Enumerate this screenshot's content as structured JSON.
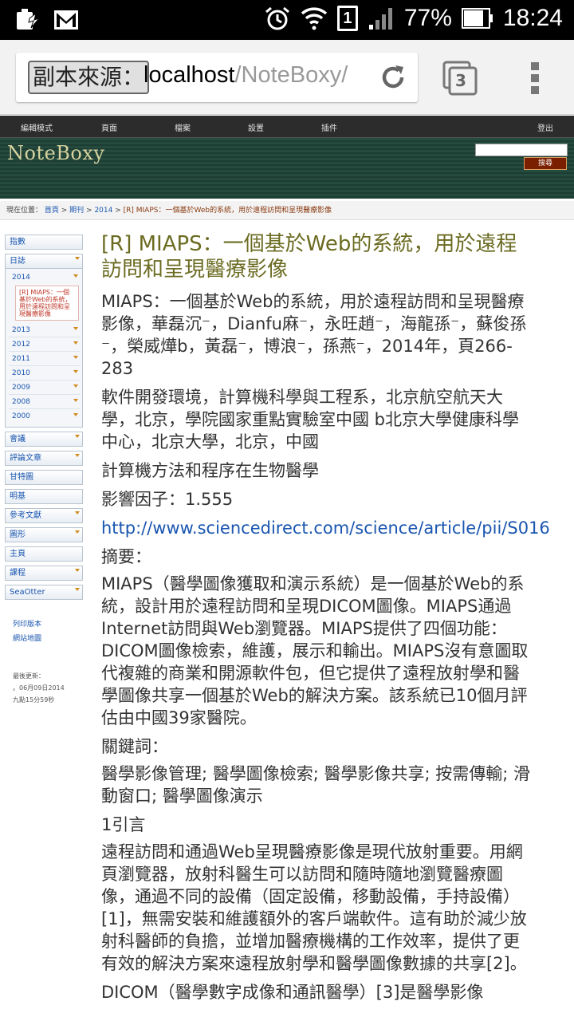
{
  "status_bar": {
    "battery_pct": "77%",
    "time": "18:24",
    "sim_slot": "1"
  },
  "browser": {
    "chip_label": "副本來源：",
    "url_host": "localhost",
    "url_path": "/NoteBoxy/",
    "tab_count": "3"
  },
  "site_nav": {
    "items": [
      "編輯模式",
      "頁面",
      "檔案",
      "設置",
      "插件"
    ],
    "logout": "登出"
  },
  "header": {
    "logo": "NoteBoxy",
    "search_btn": "搜尋"
  },
  "breadcrumb": {
    "prefix": "現在位置：",
    "home": "首頁",
    "journal": "期刊",
    "year": "2014",
    "current": "[R] MIAPS：一個基於Web的系統，用於遠程訪問和呈現醫療影像",
    "sep": " > "
  },
  "sidebar": {
    "index": "指數",
    "log": "日誌",
    "year_open": "2014",
    "current_entry": "[R] MIAPS：一個基於Web的系統，用於遠程訪問和呈現醫療影像",
    "years": [
      "2013",
      "2012",
      "2011",
      "2010",
      "2009",
      "2008",
      "2000"
    ],
    "items": [
      "會議",
      "評論文章",
      "甘特圖",
      "明基",
      "參考文獻",
      "圖形",
      "主頁",
      "課程",
      "SeaOtter"
    ],
    "print": "列印版本",
    "sitemap": "網站地圖",
    "updated_label": "最後更新：",
    "updated_date": "。06月09日2014",
    "updated_time": "九點15分59秒"
  },
  "article": {
    "title": "[R] MIAPS：一個基於Web的系統，用於遠程訪問和呈現醫療影像",
    "citation": "MIAPS：一個基於Web的系統，用於遠程訪問和呈現醫療影像，華磊沉⁻，Dianfu麻⁻，永旺趙⁻，海龍孫⁻，蘇俊孫⁻，榮威燁b，黃磊⁻，博浪⁻，孫燕⁻，2014年，頁266-283",
    "affiliation": "軟件開發環境，計算機科學與工程系，北京航空航天大學，北京，學院國家重點實驗室中國 b北京大學健康科學中心，北京大學，北京，中國",
    "journal": "計算機方法和程序在生物醫學",
    "impact": "影響因子：1.555",
    "link": "http://www.sciencedirect.com/science/article/pii/S016",
    "abstract_h": "摘要：",
    "abstract": "MIAPS（醫學圖像獲取和演示系統）是一個基於Web的系統，設計用於遠程訪問和呈現DICOM圖像。MIAPS通過Internet訪問與Web瀏覽器。MIAPS提供了四個功能：DICOM圖像檢索，維護，展示和輸出。MIAPS沒有意圖取代複雜的商業和開源軟件包，但它提供了遠程放射學和醫學圖像共享一個基於Web的解決方案。該系統已10個月評估由中國39家醫院。",
    "keywords_h": "關鍵詞：",
    "keywords": "醫學影像管理; 醫學圖像檢索; 醫學影像共享; 按需傳輸; 滑動窗口; 醫學圖像演示",
    "intro_h": "1引言",
    "intro": "遠程訪問和通過Web呈現醫療影像是現代放射重要。用網頁瀏覽器，放射科醫生可以訪問和隨時隨地瀏覽醫療圖像，通過不同的設備（固定設備，移動設備，手持設備）[1]，無需安裝和維護額外的客戶端軟件。這有助於減少放射科醫師的負擔，並增加醫療機構的工作效率，提供了更有效的解決方案來遠程放射學和醫學圖像數據的共享[2]。",
    "next": "DICOM（醫學數字成像和通訊醫學）[3]是醫學影像"
  }
}
